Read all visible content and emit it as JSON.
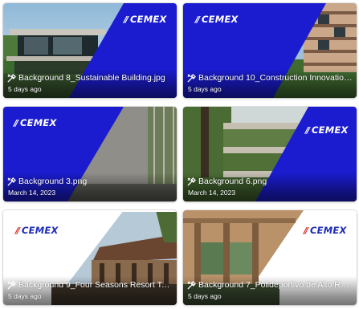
{
  "brand": {
    "logo_text": "CEMEX",
    "primary_blue": "#1b1ccf",
    "accent_red": "#d62a2a"
  },
  "items": [
    {
      "title": "Background 8_Sustainable Building.jpg",
      "date": "5 days ago",
      "icon": "image-file-icon"
    },
    {
      "title": "Background 10_Construction Innovation.j...",
      "date": "5 days ago",
      "icon": "image-file-icon"
    },
    {
      "title": "Background 3.png",
      "date": "March 14, 2023",
      "icon": "image-file-icon"
    },
    {
      "title": "Background 6.png",
      "date": "March 14, 2023",
      "icon": "image-file-icon"
    },
    {
      "title": "Background 9_Four Seasons Resort Tama...",
      "date": "5 days ago",
      "icon": "image-file-icon"
    },
    {
      "title": "Background 7_Polideportivo de Alto Ren...",
      "date": "5 days ago",
      "icon": "image-file-icon"
    }
  ]
}
